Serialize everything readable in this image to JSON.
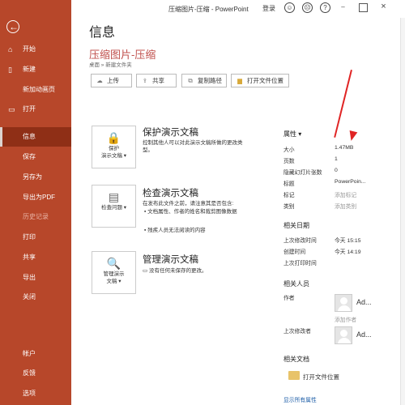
{
  "window": {
    "title": "压缩图片-压缩 - PowerPoint",
    "login": "登录",
    "icons": [
      "smile-icon",
      "frown-icon",
      "help-icon",
      "minimize-icon",
      "restore-icon",
      "close-icon"
    ]
  },
  "sidebar": {
    "items": [
      {
        "label": "开始",
        "icon": "home-icon"
      },
      {
        "label": "新建",
        "icon": "new-doc-icon"
      },
      {
        "label": "新加动画页",
        "icon": ""
      },
      {
        "label": "打开",
        "icon": "folder-icon"
      },
      {
        "label": "信息",
        "selected": true
      },
      {
        "label": "保存"
      },
      {
        "label": "另存为"
      },
      {
        "label": "导出为PDF"
      },
      {
        "label": "历史记录",
        "dim": true
      },
      {
        "label": "打印"
      },
      {
        "label": "共享"
      },
      {
        "label": "导出"
      },
      {
        "label": "关闭"
      },
      {
        "label": "帐户"
      },
      {
        "label": "反馈"
      },
      {
        "label": "选项"
      }
    ]
  },
  "main": {
    "heading": "信息",
    "doc_title": "压缩图片-压缩",
    "breadcrumb": "桌面 » 新建文件夹",
    "buttons": [
      "上传",
      "共享",
      "复制路径",
      "打开文件位置"
    ],
    "sections": [
      {
        "card": "保护\n演示文稿",
        "title": "保护演示文稿",
        "desc": "控制其他人可以对此演示文稿所做的更改类型。"
      },
      {
        "card": "检查问题",
        "title": "检查演示文稿",
        "desc": "在发布此文件之前，请注意其是否包含:",
        "bullets": [
          "文档属性、作者的姓名和裁剪图像数据",
          "残疾人员无法阅读的内容"
        ]
      },
      {
        "card": "管理演示\n文稿",
        "title": "管理演示文稿",
        "desc": "没有任何未保存的更改。"
      }
    ]
  },
  "properties": {
    "heading": "属性",
    "rows": [
      {
        "label": "大小",
        "value": "1.47MB"
      },
      {
        "label": "页数",
        "value": "1"
      },
      {
        "label": "隐藏幻灯片张数",
        "value": "0"
      },
      {
        "label": "标题",
        "value": "PowerPoin..."
      },
      {
        "label": "标记",
        "value": "添加标记"
      },
      {
        "label": "类别",
        "value": "添加类别"
      }
    ],
    "dates_heading": "相关日期",
    "dates": [
      {
        "label": "上次修改时间",
        "value": "今天 15:15"
      },
      {
        "label": "创建时间",
        "value": "今天 14:19"
      },
      {
        "label": "上次打印时间",
        "value": ""
      }
    ],
    "people_heading": "相关人员",
    "author_label": "作者",
    "author_name": "Ad...",
    "add_author": "添加作者",
    "modifier_label": "上次修改者",
    "modifier_name": "Ad...",
    "docs_heading": "相关文档",
    "open_folder": "打开文件位置",
    "show_all": "显示所有属性"
  }
}
